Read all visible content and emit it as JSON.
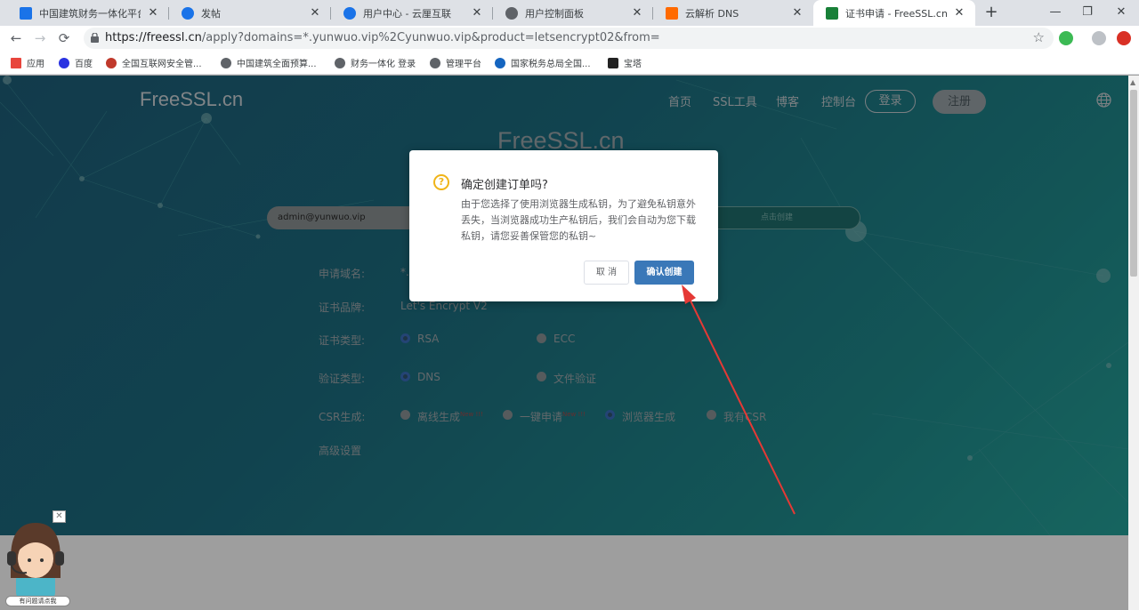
{
  "browser": {
    "tabs": [
      {
        "label": "中国建筑财务一体化平台",
        "icon": "building-favicon",
        "color": "#1a73e8"
      },
      {
        "label": "发帖",
        "icon": "a-favicon",
        "color": "#1a73e8"
      },
      {
        "label": "用户中心 - 云厘互联",
        "icon": "a-favicon",
        "color": "#1a73e8"
      },
      {
        "label": "用户控制面板",
        "icon": "globe-favicon",
        "color": "#5f6368"
      },
      {
        "label": "云解析 DNS",
        "icon": "aliyun-favicon",
        "color": "#ff6a00"
      },
      {
        "label": "证书申请 - FreeSSL.cn一个提",
        "icon": "lock-favicon",
        "color": "#188038",
        "active": true
      }
    ],
    "new_tab": "+",
    "window_controls": {
      "minimize": "—",
      "maximize": "❐",
      "close": "✕"
    },
    "nav": {
      "back": "←",
      "forward": "→",
      "reload": "⟳"
    },
    "url_host": "https://freessl.cn",
    "url_rest": "/apply?domains=*.yunwuo.vip%2Cyunwuo.vip&product=letsencrypt02&from=",
    "star": "☆",
    "bookmarks": [
      {
        "label": "应用",
        "icon": "apps-icon",
        "color": "#e8453c"
      },
      {
        "label": "百度",
        "icon": "baidu-icon",
        "color": "#2932e1"
      },
      {
        "label": "全国互联网安全管...",
        "icon": "emblem-icon",
        "color": "#c0392b"
      },
      {
        "label": "中国建筑全面预算...",
        "icon": "globe-icon",
        "color": "#5f6368"
      },
      {
        "label": "财务一体化 登录",
        "icon": "globe-icon",
        "color": "#5f6368"
      },
      {
        "label": "管理平台",
        "icon": "globe-icon",
        "color": "#5f6368"
      },
      {
        "label": "国家税务总局全国...",
        "icon": "tax-icon",
        "color": "#1565c0"
      },
      {
        "label": "宝塔",
        "icon": "bt-icon",
        "color": "#222222"
      }
    ]
  },
  "site": {
    "logo": "FreeSSL.cn",
    "nav": [
      "首页",
      "SSL工具",
      "博客",
      "控制台"
    ],
    "login": "登录",
    "register": "注册",
    "hero_title": "FreeSSL.cn",
    "email_value": "admin@yunwuo.vip",
    "create_button": "点击创建",
    "form": {
      "domain_label": "申请域名:",
      "domain_value": "*.",
      "brand_label": "证书品牌:",
      "brand_value": "Let's Encrypt V2",
      "cert_type_label": "证书类型:",
      "cert_types": [
        "RSA",
        "ECC"
      ],
      "verify_label": "验证类型:",
      "verify_types": [
        "DNS",
        "文件验证"
      ],
      "csr_label": "CSR生成:",
      "csr_options": [
        "离线生成",
        "一键申请",
        "浏览器生成",
        "我有CSR"
      ],
      "new_tag": "New !!!",
      "advanced": "高级设置"
    }
  },
  "dialog": {
    "title": "确定创建订单吗?",
    "message": "由于您选择了使用浏览器生成私钥，为了避免私钥意外丢失，当浏览器成功生产私钥后，我们会自动为您下载私钥，请您妥善保管您的私钥~",
    "cancel": "取 消",
    "confirm": "确认创建"
  },
  "widget": {
    "close": "✕",
    "label": "有问题请点我"
  }
}
